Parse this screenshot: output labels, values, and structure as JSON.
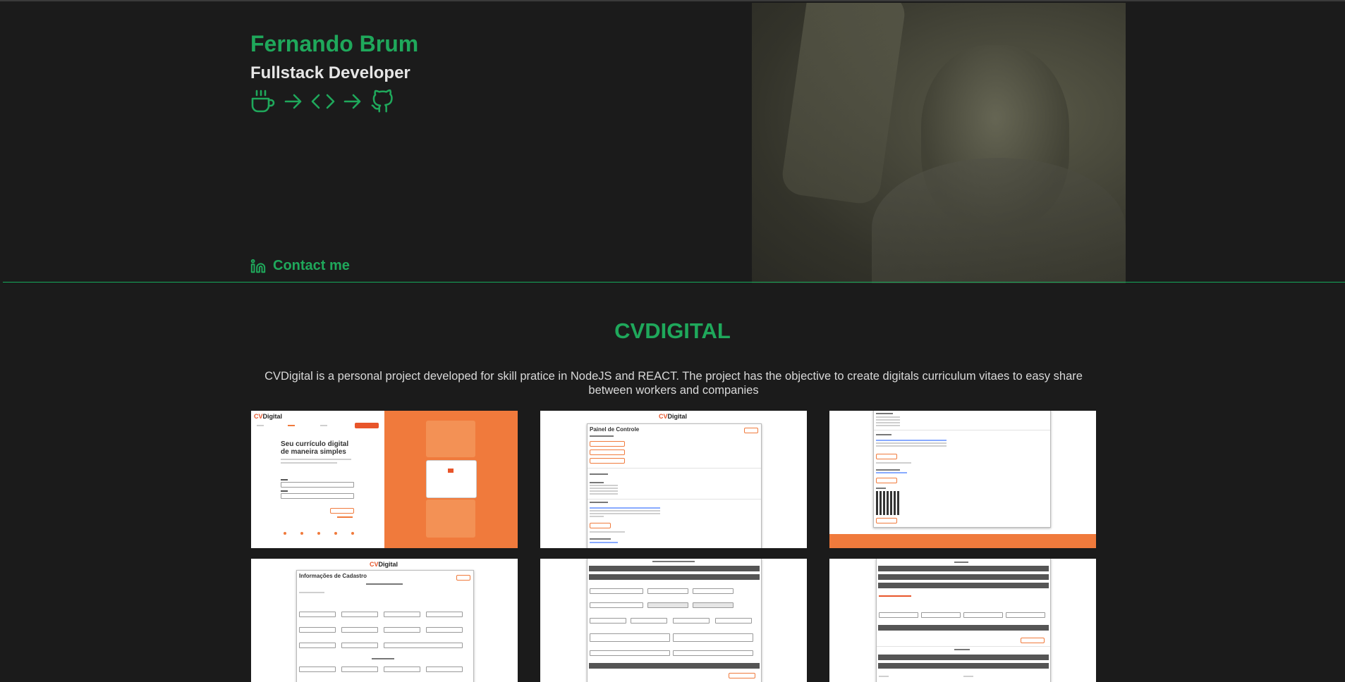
{
  "hero": {
    "name": "Fernando Brum",
    "role": "Fullstack Developer",
    "icons": [
      "coffee-icon",
      "arrow-right-icon",
      "code-icon",
      "arrow-right-icon",
      "github-icon"
    ],
    "contact": {
      "icon": "linkedin-icon",
      "label": "Contact me"
    }
  },
  "project": {
    "title": "CVDIGITAL",
    "description": "CVDigital is a personal project developed for skill pratice in NodeJS and REACT. The project has the objective to create digitals curriculum vitaes to easy share between workers and companies",
    "screens": {
      "login": {
        "logo_cv": "CV",
        "logo_rest": "Digital",
        "heading": "Seu currículo digital de maneira simples"
      },
      "dashboard": {
        "logo_cv": "CV",
        "logo_rest": "Digital",
        "heading": "Painel de Controle"
      },
      "registration": {
        "logo_cv": "CV",
        "logo_rest": "Digital",
        "heading": "Informações de Cadastro"
      }
    }
  },
  "colors": {
    "accent": "#1fa85b",
    "background": "#1b1b1b",
    "brand_orange": "#f07a3c"
  }
}
